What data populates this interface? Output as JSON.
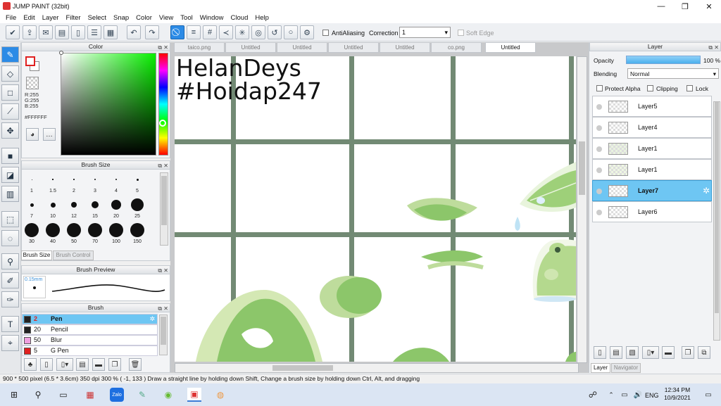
{
  "window": {
    "title": "JUMP PAINT (32bit)",
    "controls": [
      "—",
      "❐",
      "✕"
    ]
  },
  "menu": [
    "File",
    "Edit",
    "Layer",
    "Filter",
    "Select",
    "Snap",
    "Color",
    "View",
    "Tool",
    "Window",
    "Cloud",
    "Help"
  ],
  "toolbar": {
    "antialiasing_label": "AntiAliasing",
    "correction_label": "Correction",
    "correction_value": "1",
    "soft_edge_label": "Soft Edge"
  },
  "color_panel": {
    "title": "Color",
    "r": "R:255",
    "g": "G:255",
    "b": "B:255",
    "hex": "#FFFFFF"
  },
  "brush_size_panel": {
    "title": "Brush Size",
    "sizes": [
      "1",
      "1.5",
      "2",
      "3",
      "4",
      "5",
      "7",
      "10",
      "12",
      "15",
      "20",
      "25",
      "30",
      "40",
      "50",
      "70",
      "100",
      "150"
    ],
    "tabs": [
      "Brush Size",
      "Brush Control"
    ]
  },
  "brush_preview_panel": {
    "title": "Brush Preview",
    "size_label": "0.15mm"
  },
  "brush_panel": {
    "title": "Brush",
    "items": [
      {
        "size": "2",
        "name": "Pen",
        "color": "#222222",
        "active": true
      },
      {
        "size": "20",
        "name": "Pencil",
        "color": "#222222",
        "active": false
      },
      {
        "size": "50",
        "name": "Blur",
        "color": "#f0a0e0",
        "active": false
      },
      {
        "size": "5",
        "name": "G Pen",
        "color": "#e02020",
        "active": false
      }
    ]
  },
  "doc_tabs": [
    "taico.png",
    "Untitled",
    "Untitled",
    "Untitled",
    "Untitled",
    "co.png",
    "Untitled"
  ],
  "canvas": {
    "text_line1": "HelanDeys",
    "text_line2": "#Hoidap247"
  },
  "layer_panel": {
    "title": "Layer",
    "opacity_label": "Opacity",
    "opacity_value": "100 %",
    "opacity_fraction": 1.0,
    "blending_label": "Blending",
    "blending_value": "Normal",
    "protect_alpha_label": "Protect Alpha",
    "clipping_label": "Clipping",
    "lock_label": "Lock",
    "layers": [
      {
        "name": "Layer5",
        "active": false
      },
      {
        "name": "Layer4",
        "active": false
      },
      {
        "name": "Layer1",
        "active": false
      },
      {
        "name": "Layer1",
        "active": false
      },
      {
        "name": "Layer7",
        "active": true
      },
      {
        "name": "Layer6",
        "active": false
      }
    ],
    "bottom_tabs": [
      "Layer",
      "Navigator"
    ]
  },
  "status": {
    "text": "900 * 500 pixel   (6.5 * 3.6cm)   350 dpi   300 %   ( -1, 133 )   Draw a straight line by holding down Shift, Change a brush size by holding down Ctrl, Alt, and dragging"
  },
  "taskbar": {
    "lang": "ENG",
    "time": "12:34 PM",
    "date": "10/9/2021"
  },
  "colors": {
    "accent": "#2c8be6",
    "selected_row": "#6ec6f3",
    "leaf_green": "#8cc66a"
  }
}
